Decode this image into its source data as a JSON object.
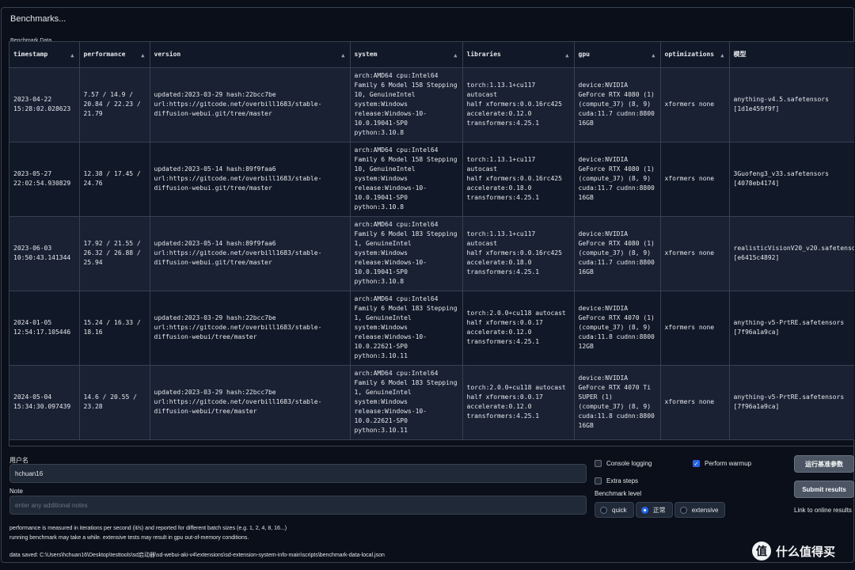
{
  "panel": {
    "title": "Benchmarks...",
    "table_label": "Benchmark Data"
  },
  "table": {
    "columns": [
      "timestamp",
      "performance",
      "version",
      "system",
      "libraries",
      "gpu",
      "optimizations",
      "模型"
    ],
    "rows": [
      [
        "2023-04-22\n15:28:02.028623",
        "7.57 / 14.9 /\n20.84 / 22.23 /\n21.79",
        "updated:2023-03-29 hash:22bcc7be\nurl:https://gitcode.net/overbill1683/stable-\ndiffusion-webui.git/tree/master",
        "arch:AMD64 cpu:Intel64\nFamily 6 Model 158 Stepping\n10, GenuineIntel\nsystem:Windows\nrelease:Windows-10-\n10.0.19041-SP0\npython:3.10.8",
        "torch:1.13.1+cu117 autocast\nhalf xformers:0.0.16rc425\naccelerate:0.12.0\ntransformers:4.25.1",
        "device:NVIDIA\nGeForce RTX 4080 (1)\n(compute_37) (8, 9)\ncuda:11.7 cudnn:8800\n16GB",
        "xformers none",
        "anything-v4.5.safetensors\n[1d1e459f9f]"
      ],
      [
        "2023-05-27\n22:02:54.930829",
        "12.38 / 17.45 /\n24.76",
        "updated:2023-05-14 hash:89f9faa6\nurl:https://gitcode.net/overbill1683/stable-\ndiffusion-webui.git/tree/master",
        "arch:AMD64 cpu:Intel64\nFamily 6 Model 158 Stepping\n10, GenuineIntel\nsystem:Windows\nrelease:Windows-10-\n10.0.19041-SP0\npython:3.10.8",
        "torch:1.13.1+cu117 autocast\nhalf xformers:0.0.16rc425\naccelerate:0.18.0\ntransformers:4.25.1",
        "device:NVIDIA\nGeForce RTX 4080 (1)\n(compute_37) (8, 9)\ncuda:11.7 cudnn:8800\n16GB",
        "xformers none",
        "3Guofeng3_v33.safetensors\n[4078eb4174]"
      ],
      [
        "2023-06-03\n10:50:43.141344",
        "17.92 / 21.55 /\n26.32 / 26.88 /\n25.94",
        "updated:2023-05-14 hash:89f9faa6\nurl:https://gitcode.net/overbill1683/stable-\ndiffusion-webui.git/tree/master",
        "arch:AMD64 cpu:Intel64\nFamily 6 Model 183 Stepping\n1, GenuineIntel\nsystem:Windows\nrelease:Windows-10-\n10.0.19041-SP0\npython:3.10.8",
        "torch:1.13.1+cu117 autocast\nhalf xformers:0.0.16rc425\naccelerate:0.18.0\ntransformers:4.25.1",
        "device:NVIDIA\nGeForce RTX 4080 (1)\n(compute_37) (8, 9)\ncuda:11.7 cudnn:8800\n16GB",
        "xformers none",
        "realisticVisionV20_v20.safetensors\n[e6415c4892]"
      ],
      [
        "2024-01-05\n12:54:17.105446",
        "15.24 / 16.33 /\n18.16",
        "updated:2023-03-29 hash:22bcc7be\nurl:https://gitcode.net/overbill1683/stable-\ndiffusion-webui/tree/master",
        "arch:AMD64 cpu:Intel64\nFamily 6 Model 183 Stepping\n1, GenuineIntel\nsystem:Windows\nrelease:Windows-10-\n10.0.22621-SP0\npython:3.10.11",
        "torch:2.0.0+cu118 autocast\nhalf xformers:0.0.17\naccelerate:0.12.0\ntransformers:4.25.1",
        "device:NVIDIA\nGeForce RTX 4070 (1)\n(compute_37) (8, 9)\ncuda:11.8 cudnn:8800\n12GB",
        "xformers none",
        "anything-v5-PrtRE.safetensors\n[7f96a1a9ca]"
      ],
      [
        "2024-05-04\n15:34:30.097439",
        "14.6 / 20.55 /\n23.28",
        "updated:2023-03-29 hash:22bcc7be\nurl:https://gitcode.net/overbill1683/stable-\ndiffusion-webui/tree/master",
        "arch:AMD64 cpu:Intel64\nFamily 6 Model 183 Stepping\n1, GenuineIntel\nsystem:Windows\nrelease:Windows-10-\n10.0.22621-SP0\npython:3.10.11",
        "torch:2.0.0+cu118 autocast\nhalf xformers:0.0.17\naccelerate:0.12.0\ntransformers:4.25.1",
        "device:NVIDIA\nGeForce RTX 4070 Ti\nSUPER (1)\n(compute_37) (8, 9)\ncuda:11.8 cudnn:8800\n16GB",
        "xformers none",
        "anything-v5-PrtRE.safetensors\n[7f96a1a9ca]"
      ]
    ]
  },
  "form": {
    "username_label": "用户名",
    "username_value": "hchuan16",
    "note_label": "Note",
    "note_placeholder": "enter any additional notes",
    "console_logging": "Console logging",
    "perform_warmup": "Perform warmup",
    "extra_steps": "Extra steps",
    "benchmark_level_label": "Benchmark level",
    "levels": [
      "quick",
      "正常",
      "extensive"
    ],
    "selected_level": "正常",
    "run_button": "运行基准参数",
    "submit_button": "Submit results",
    "online_link": "Link to online results"
  },
  "info": {
    "line1": "performance is measured in iterations per second (it/s) and reported for different batch sizes (e.g. 1, 2, 4, 8, 16...)",
    "line2": "running benchmark may take a while. extensive tests may result in gpu out-of-memory conditions.",
    "saved": "data saved: C:\\Users\\hchuan16\\Desktop\\testtools\\sd启动器\\sd-webui-aki-v4\\extensions\\sd-extension-system-info-main\\scripts\\benchmark-data-local.json"
  },
  "watermark": {
    "logo_glyph": "值",
    "text": "什么值得买"
  }
}
